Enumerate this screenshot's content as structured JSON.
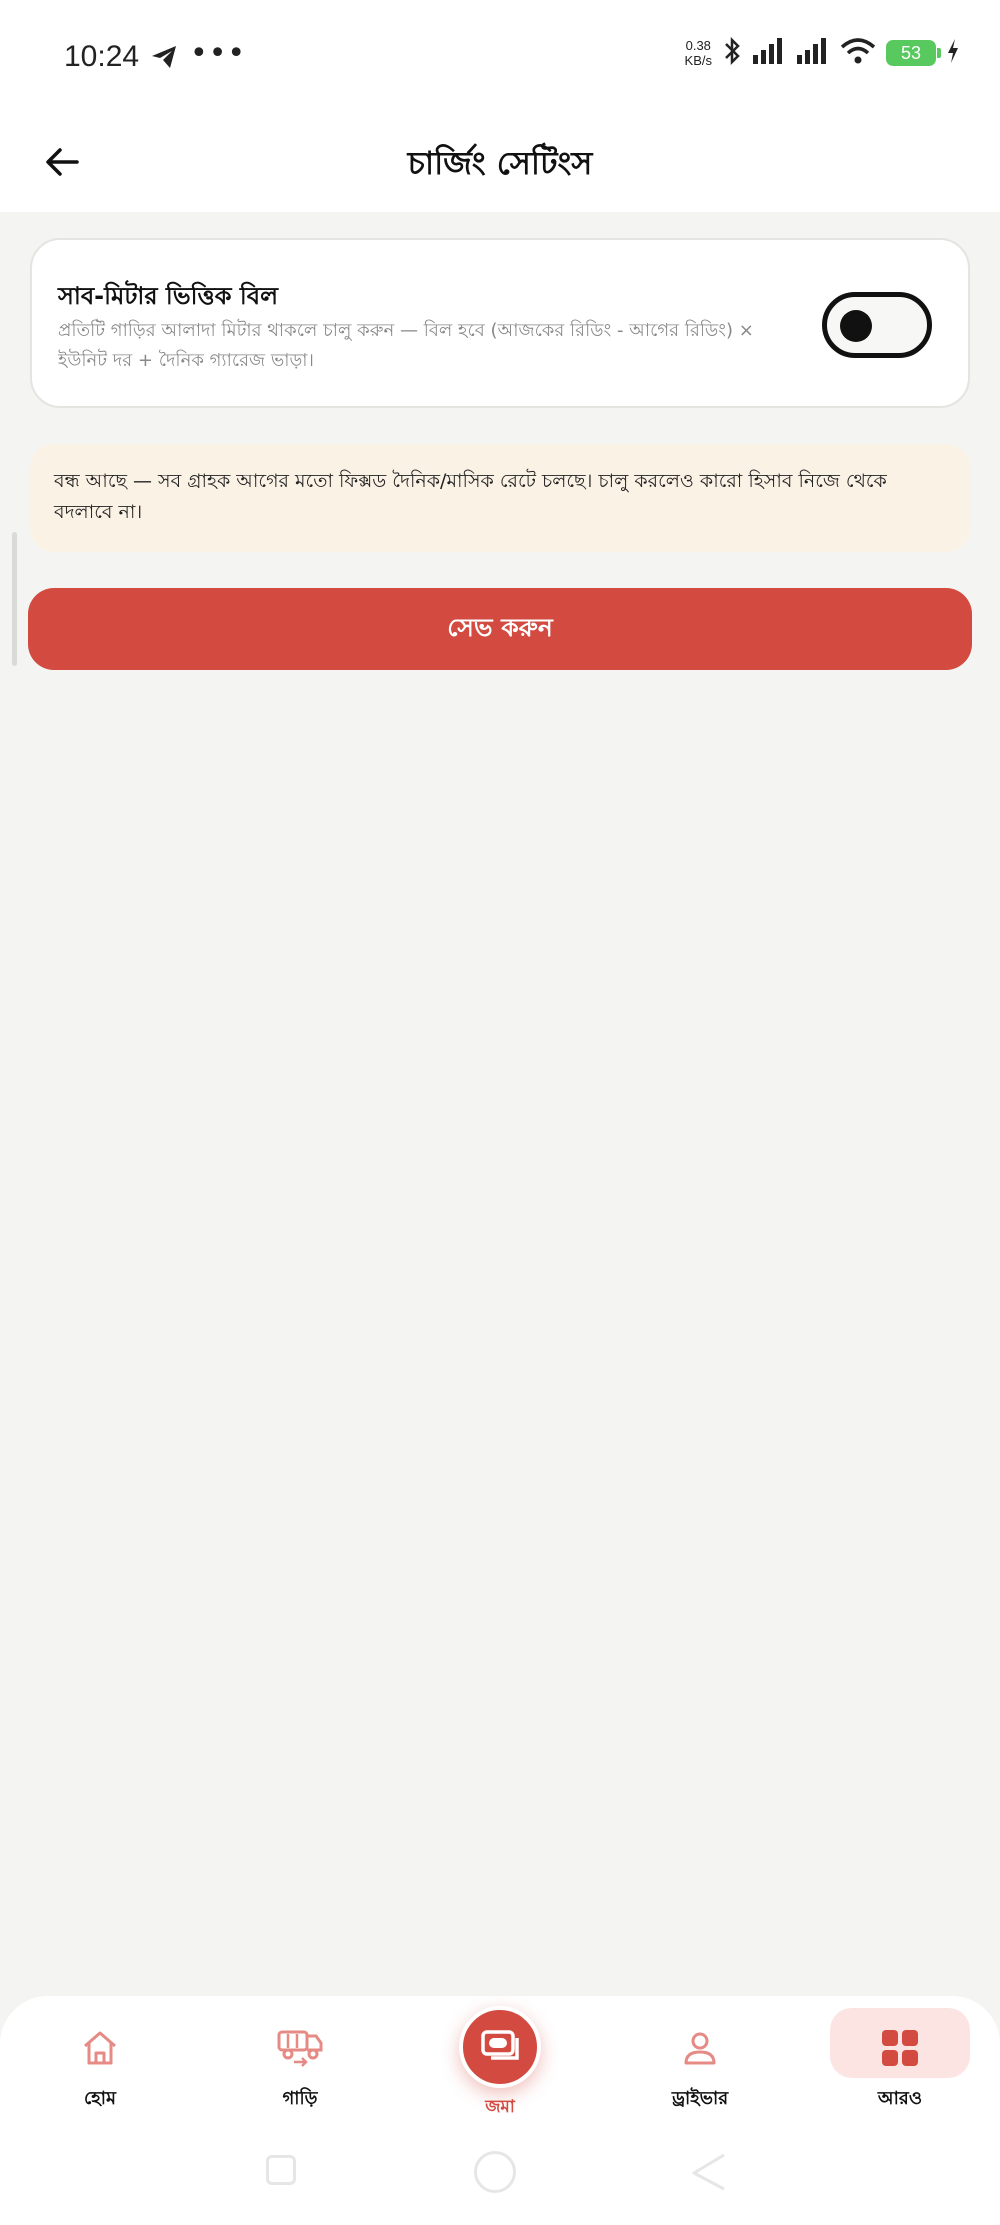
{
  "status_bar": {
    "time": "10:24",
    "dots": "•••",
    "net_speed_value": "0.38",
    "net_speed_unit": "KB/s",
    "battery": "53",
    "icons": [
      "telegram-icon",
      "bluetooth-icon",
      "signal-icon",
      "signal-icon",
      "wifi-icon",
      "battery-icon",
      "charging-icon"
    ]
  },
  "header": {
    "title": "চার্জিং সেটিংস",
    "back_icon": "arrow-left-icon"
  },
  "setting_card": {
    "title": "সাব-মিটার ভিত্তিক বিল",
    "description": "প্রতিটি গাড়ির আলাদা মিটার থাকলে চালু করুন — বিল হবে (আজকের রিডিং - আগের রিডিং) × ইউনিট দর + দৈনিক গ্যারেজ ভাড়া।",
    "toggle_on": false
  },
  "notice": {
    "text": "বন্ধ আছে — সব গ্রাহক আগের মতো ফিক্সড দৈনিক/মাসিক রেটে চলছে। চালু করলেও কারো হিসাব নিজে থেকে বদলাবে না।"
  },
  "save_button": {
    "label": "সেভ করুন"
  },
  "bottom_nav": {
    "items": [
      {
        "label": "হোম",
        "icon": "home-icon",
        "active": false
      },
      {
        "label": "গাড়ি",
        "icon": "vehicle-icon",
        "active": false
      },
      {
        "label": "জমা",
        "icon": "cash-icon",
        "active": false,
        "fab": true
      },
      {
        "label": "ড্রাইভার",
        "icon": "user-icon",
        "active": false
      },
      {
        "label": "আরও",
        "icon": "grid-icon",
        "active": true
      }
    ]
  },
  "colors": {
    "accent": "#d24a40",
    "notice_bg": "#fbf2e6",
    "page_bg": "#f4f5f2",
    "active_tab_bg": "#fbe4e2"
  }
}
